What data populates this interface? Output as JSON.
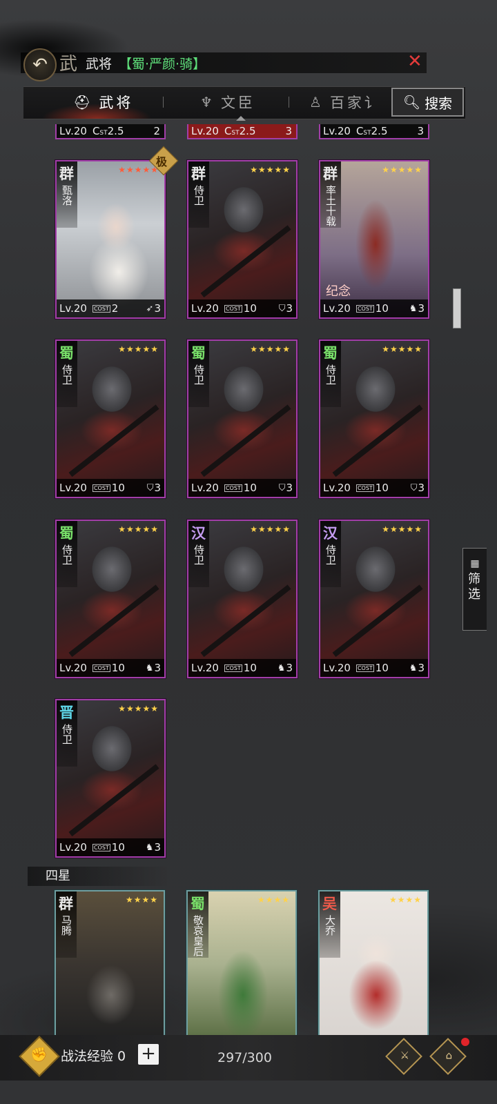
{
  "header": {
    "back_icon": "back-arrow-icon",
    "title_char": "武",
    "title": "武将",
    "filter_text": "【蜀·严颜·骑】",
    "close_icon": "close-icon"
  },
  "tabs": [
    {
      "label": "武将",
      "icon": "helmet-icon",
      "active": true
    },
    {
      "label": "文臣",
      "icon": "scholar-icon",
      "active": false
    },
    {
      "label": "百家讠",
      "icon": "sage-icon",
      "active": false
    }
  ],
  "search": {
    "label": "搜索",
    "icon": "search-icon"
  },
  "cut_cards": [
    {
      "lv": "Lv.20",
      "cost": "2.5",
      "unit": "2"
    },
    {
      "lv": "Lv.20",
      "cost": "2.5",
      "unit": "3"
    },
    {
      "lv": "Lv.20",
      "cost": "2.5",
      "unit": "3"
    }
  ],
  "cards": [
    {
      "faction": "群",
      "name": "甄洛",
      "stars": "★★★★★",
      "lv": "Lv.20",
      "cost": "2",
      "unit": "3",
      "unit_icon": "bow-icon",
      "tag": "极"
    },
    {
      "faction": "群",
      "name": "侍卫",
      "stars": "★★★★★",
      "lv": "Lv.20",
      "cost": "10",
      "unit": "3",
      "unit_icon": "shield-icon"
    },
    {
      "faction": "群",
      "name": "率土十载",
      "stars": "★★★★★",
      "lv": "Lv.20",
      "cost": "10",
      "unit": "3",
      "unit_icon": "horse-icon",
      "banner": "纪念"
    },
    {
      "faction": "蜀",
      "name": "侍卫",
      "stars": "★★★★★",
      "lv": "Lv.20",
      "cost": "10",
      "unit": "3",
      "unit_icon": "shield-icon"
    },
    {
      "faction": "蜀",
      "name": "侍卫",
      "stars": "★★★★★",
      "lv": "Lv.20",
      "cost": "10",
      "unit": "3",
      "unit_icon": "shield-icon"
    },
    {
      "faction": "蜀",
      "name": "侍卫",
      "stars": "★★★★★",
      "lv": "Lv.20",
      "cost": "10",
      "unit": "3",
      "unit_icon": "shield-icon"
    },
    {
      "faction": "蜀",
      "name": "侍卫",
      "stars": "★★★★★",
      "lv": "Lv.20",
      "cost": "10",
      "unit": "3",
      "unit_icon": "horse-icon"
    },
    {
      "faction": "汉",
      "name": "侍卫",
      "stars": "★★★★★",
      "lv": "Lv.20",
      "cost": "10",
      "unit": "3",
      "unit_icon": "horse-icon"
    },
    {
      "faction": "汉",
      "name": "侍卫",
      "stars": "★★★★★",
      "lv": "Lv.20",
      "cost": "10",
      "unit": "3",
      "unit_icon": "horse-icon"
    },
    {
      "faction": "晋",
      "name": "侍卫",
      "stars": "★★★★★",
      "lv": "Lv.20",
      "cost": "10",
      "unit": "3",
      "unit_icon": "horse-icon"
    }
  ],
  "section_four_star": "四星",
  "four_star_cards": [
    {
      "faction": "群",
      "name": "马腾",
      "stars": "★★★★"
    },
    {
      "faction": "蜀",
      "name": "敬哀皇后",
      "stars": "★★★★"
    },
    {
      "faction": "吴",
      "name": "大乔",
      "stars": "★★★★"
    }
  ],
  "cost_label": "COST",
  "filter_button": {
    "label": "筛选",
    "icon": "grid-icon"
  },
  "bottom": {
    "exp_icon": "fist-icon",
    "exp_label": "战法经验 0",
    "plus": "+",
    "count": "297/300",
    "btn1_icon": "strategy-icon",
    "btn2_icon": "pavilion-icon"
  }
}
